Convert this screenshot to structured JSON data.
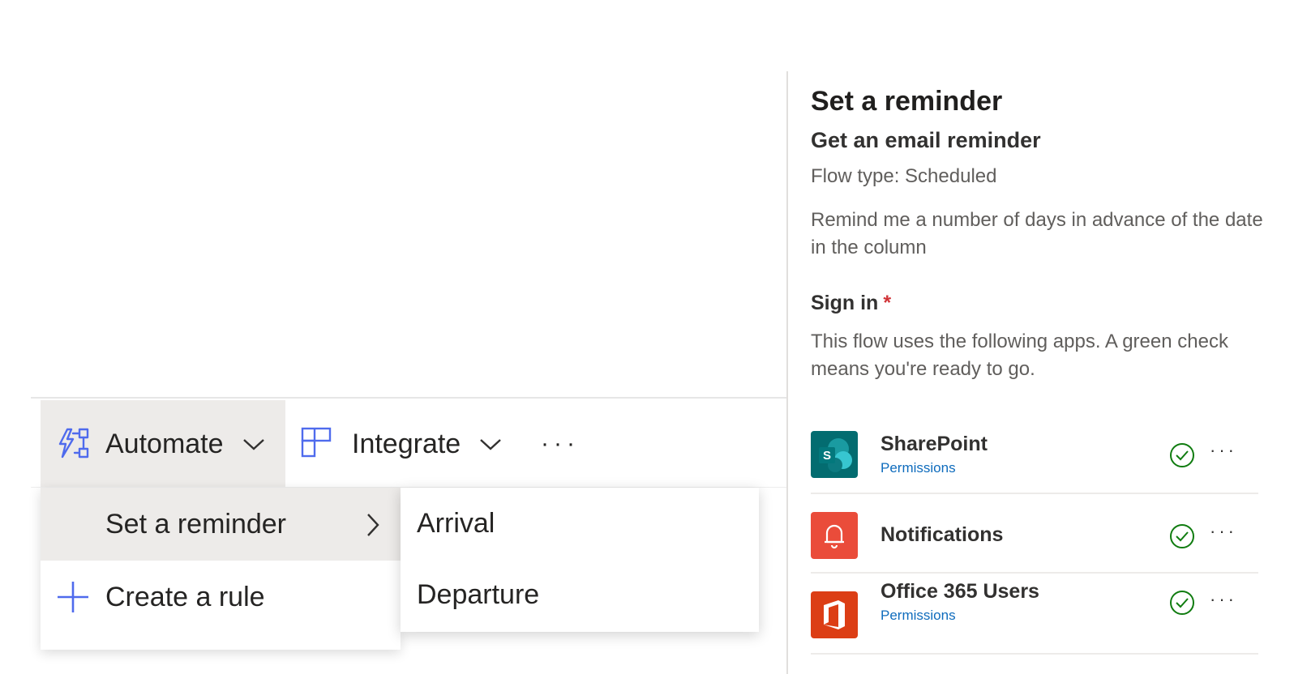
{
  "command_bar": {
    "automate_label": "Automate",
    "integrate_label": "Integrate",
    "more_label": "···"
  },
  "automate_menu": {
    "items": [
      {
        "label": "Set a reminder",
        "has_submenu": true,
        "highlighted": true
      },
      {
        "label": "Create a rule",
        "icon": "plus-icon"
      }
    ]
  },
  "reminder_submenu": {
    "items": [
      {
        "label": "Arrival"
      },
      {
        "label": "Departure"
      }
    ]
  },
  "panel": {
    "title": "Set a reminder",
    "subtitle": "Get an email reminder",
    "flow_type": "Flow type: Scheduled",
    "description": "Remind me a number of days in advance of the date in the column",
    "sign_in_label": "Sign in",
    "required_marker": "*",
    "sign_in_note": "This flow uses the following apps. A green check means you're ready to go.",
    "apps": [
      {
        "name": "SharePoint",
        "link": "Permissions",
        "icon": "sharepoint-icon",
        "color": "#036c70",
        "status": "ready"
      },
      {
        "name": "Notifications",
        "link": "",
        "icon": "bell-icon",
        "color": "#ea4c3a",
        "status": "ready"
      },
      {
        "name": "Office 365 Users",
        "link": "Permissions",
        "icon": "office-icon",
        "color": "#dc3e15",
        "status": "ready"
      }
    ],
    "more_label": "···"
  },
  "colors": {
    "accent_blue": "#4f6bed",
    "check_green": "#107c10",
    "link_blue": "#0f6cbd",
    "required_red": "#d13438"
  }
}
